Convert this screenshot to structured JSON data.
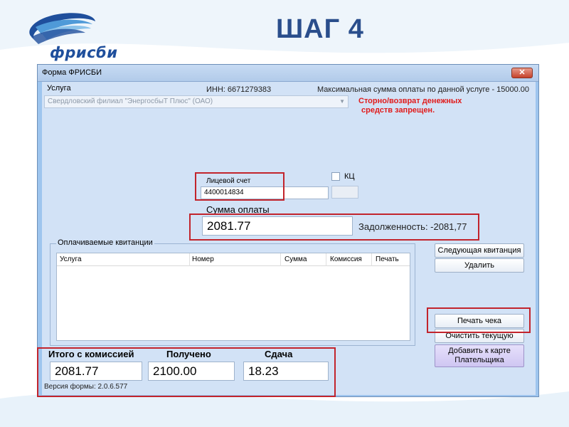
{
  "slide": {
    "logo_text": "фрисби",
    "title": "ШАГ 4"
  },
  "window": {
    "title": "Форма ФРИСБИ",
    "close_icon": "close-icon"
  },
  "form": {
    "service_label": "Услуга",
    "inn_text": "ИНН: 6671279383",
    "max_sum_text": "Максимальная сумма оплаты по данной услуге - 15000.00",
    "service_value": "Свердловский филиал  \"ЭнергосбыТ Плюс\" (ОАО)",
    "storno_line1": "Сторно/возврат денежных",
    "storno_line2": "средств запрещен.",
    "account_label": "Лицевой счет",
    "account_value": "4400014834",
    "kc_label": "КЦ",
    "sum_label": "Сумма оплаты",
    "sum_value": "2081.77",
    "debt_text": "Задолженность: -2081,77",
    "receipts_legend": "Оплачиваемые квитанции",
    "columns": [
      "Услуга",
      "Номер",
      "Сумма",
      "Комиссия",
      "Печать"
    ],
    "total_label": "Итого с комиссией",
    "received_label": "Получено",
    "change_label": "Сдача",
    "total_value": "2081.77",
    "received_value": "2100.00",
    "change_value": "18.23",
    "version_text": "Версия формы: 2.0.6.577"
  },
  "buttons": {
    "next_receipt": "Следующая квитанция",
    "delete": "Удалить",
    "print_check": "Печать чека",
    "clear_current": "Очистить текущую",
    "add_card_line1": "Добавить к карте",
    "add_card_line2": "Плательщика"
  },
  "colors": {
    "highlight": "#c2242c",
    "warning_text": "#e11b1b",
    "window_bg": "#d2e2f6",
    "title_text": "#2a4e8c"
  }
}
